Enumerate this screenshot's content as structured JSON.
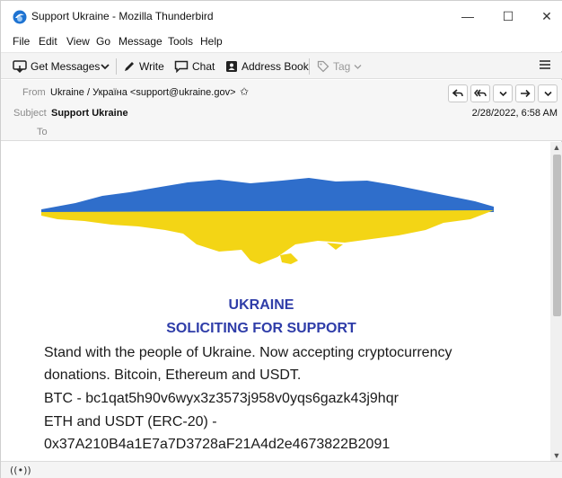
{
  "window": {
    "title": "Support Ukraine - Mozilla Thunderbird",
    "minimize_glyph": "—",
    "maximize_glyph": "☐",
    "close_glyph": "✕"
  },
  "menu": [
    {
      "label": "File"
    },
    {
      "label": "Edit"
    },
    {
      "label": "View"
    },
    {
      "label": "Go"
    },
    {
      "label": "Message"
    },
    {
      "label": "Tools"
    },
    {
      "label": "Help"
    }
  ],
  "toolbar": {
    "get_messages": "Get Messages",
    "write": "Write",
    "chat": "Chat",
    "address_book": "Address Book",
    "tag": "Tag"
  },
  "header": {
    "from_label": "From",
    "from_value": "Ukraine / Україна <support@ukraine.gov>",
    "subject_label": "Subject",
    "subject_value": "Support Ukraine",
    "to_label": "To",
    "date": "2/28/2022, 6:58 AM"
  },
  "message": {
    "heading1": "UKRAINE",
    "heading2": "SOLICITING FOR SUPPORT",
    "lines": [
      "Stand with the people of Ukraine. Now accepting cryptocurrency",
      "donations. Bitcoin, Ethereum and USDT.",
      "BTC - bc1qat5h90v6wyx3z3573j958v0yqs6gazk43j9hqr",
      "ETH and USDT (ERC-20) -",
      "0x37A210B4a1E7a7D3728aF21A4d2e4673822B2091"
    ],
    "flag_colors": {
      "blue": "#2f6ecb",
      "yellow": "#f3d515"
    }
  },
  "colors": {
    "accent_heading": "#2e3ca8",
    "app_icon": "#1e73d2"
  }
}
